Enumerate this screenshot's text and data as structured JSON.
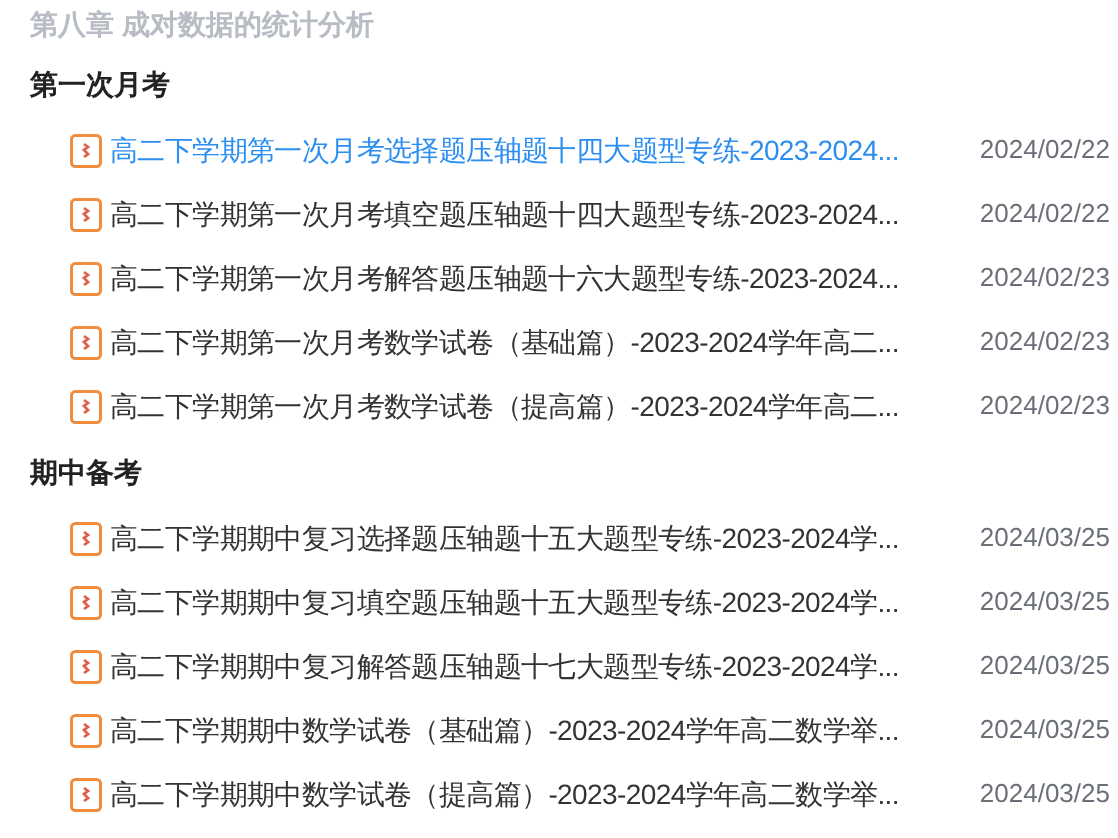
{
  "chapter_title": "第八章 成对数据的统计分析",
  "sections": [
    {
      "heading": "第一次月考",
      "files": [
        {
          "name": "高二下学期第一次月考选择题压轴题十四大题型专练-2023-2024...",
          "date": "2024/02/22",
          "selected": true
        },
        {
          "name": "高二下学期第一次月考填空题压轴题十四大题型专练-2023-2024...",
          "date": "2024/02/22",
          "selected": false
        },
        {
          "name": "高二下学期第一次月考解答题压轴题十六大题型专练-2023-2024...",
          "date": "2024/02/23",
          "selected": false
        },
        {
          "name": "高二下学期第一次月考数学试卷（基础篇）-2023-2024学年高二...",
          "date": "2024/02/23",
          "selected": false
        },
        {
          "name": "高二下学期第一次月考数学试卷（提高篇）-2023-2024学年高二...",
          "date": "2024/02/23",
          "selected": false
        }
      ]
    },
    {
      "heading": "期中备考",
      "files": [
        {
          "name": "高二下学期期中复习选择题压轴题十五大题型专练-2023-2024学...",
          "date": "2024/03/25",
          "selected": false
        },
        {
          "name": "高二下学期期中复习填空题压轴题十五大题型专练-2023-2024学...",
          "date": "2024/03/25",
          "selected": false
        },
        {
          "name": "高二下学期期中复习解答题压轴题十七大题型专练-2023-2024学...",
          "date": "2024/03/25",
          "selected": false
        },
        {
          "name": "高二下学期期中数学试卷（基础篇）-2023-2024学年高二数学举...",
          "date": "2024/03/25",
          "selected": false
        },
        {
          "name": "高二下学期期中数学试卷（提高篇）-2023-2024学年高二数学举...",
          "date": "2024/03/25",
          "selected": false
        }
      ]
    }
  ]
}
